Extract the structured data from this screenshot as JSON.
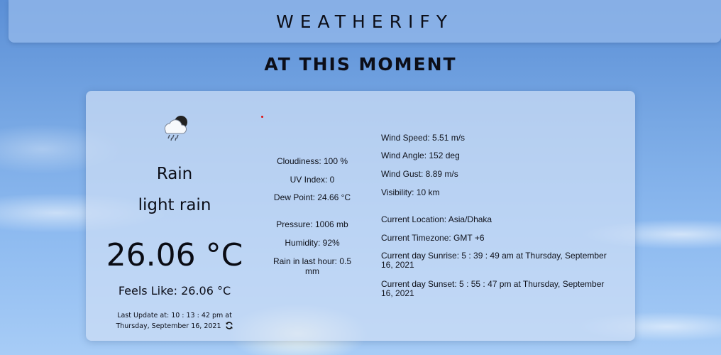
{
  "header": {
    "brand": "WEATHERIFY"
  },
  "section": {
    "title": "AT THIS MOMENT"
  },
  "current": {
    "icon": "rain-cloud-moon-icon",
    "condition": "Rain",
    "description": "light rain",
    "temperature": "26.06 °C",
    "feels_like": "Feels Like: 26.06 °C",
    "last_update": "Last Update at: 10 : 13 : 42 pm at Thursday, September 16, 2021"
  },
  "details_mid": {
    "cloudiness": "Cloudiness: 100 %",
    "uv_index": "UV Index: 0",
    "dew_point": "Dew Point: 24.66 °C",
    "pressure": "Pressure: 1006 mb",
    "humidity": "Humidity: 92%",
    "rain_last_hour": "Rain in last hour: 0.5 mm"
  },
  "details_right": {
    "wind_speed": "Wind Speed: 5.51 m/s",
    "wind_angle": "Wind Angle: 152 deg",
    "wind_gust": "Wind Gust: 8.89 m/s",
    "visibility": "Visibility: 10 km",
    "location": "Current Location: Asia/Dhaka",
    "timezone": "Current Timezone: GMT +6",
    "sunrise": "Current day Sunrise: 5 : 39 : 49 am at Thursday, September 16, 2021",
    "sunset": "Current day Sunset: 5 : 55 : 47 pm at Thursday, September 16, 2021"
  },
  "colors": {
    "sky_top": "#5b8fd6",
    "sky_bottom": "#a7ccf6",
    "text": "#0c0e18"
  }
}
